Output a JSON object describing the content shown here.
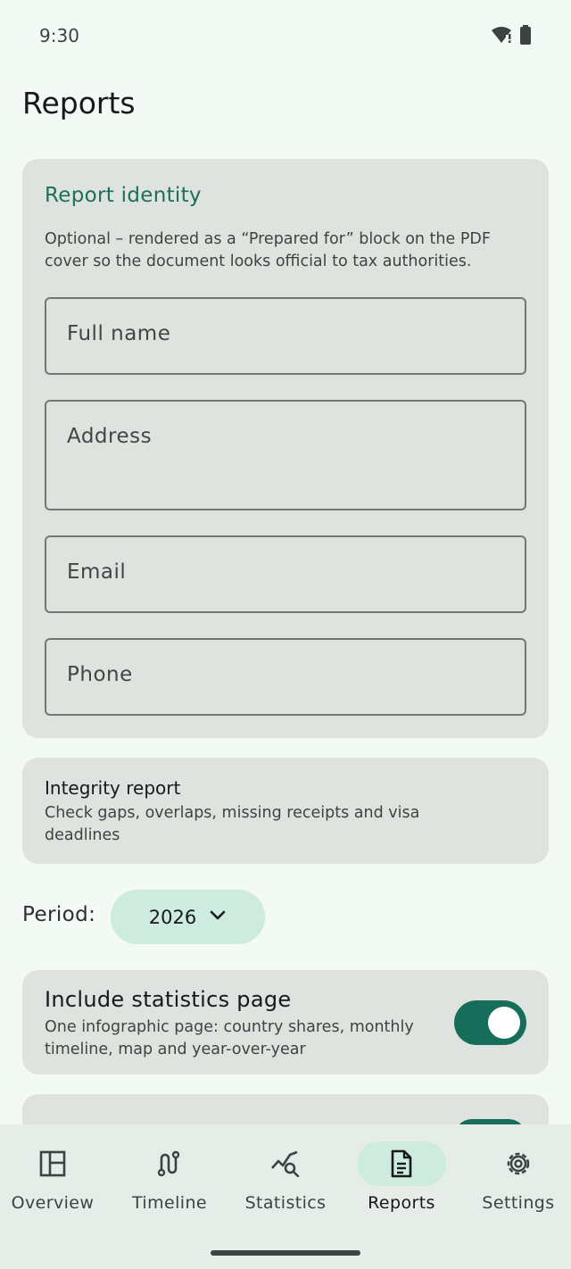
{
  "status_bar": {
    "time": "9:30"
  },
  "page": {
    "title": "Reports"
  },
  "identity": {
    "heading": "Report identity",
    "description": "Optional – rendered as a “Prepared for” block on the PDF cover so the document looks official to tax authorities.",
    "fields": {
      "full_name": "Full name",
      "address": "Address",
      "email": "Email",
      "phone": "Phone"
    }
  },
  "integrity": {
    "title": "Integrity report",
    "description": "Check gaps, overlaps, missing receipts and visa deadlines"
  },
  "period": {
    "label": "Period:",
    "value": "2026"
  },
  "statistics_option": {
    "title": "Include statistics page",
    "description": "One infographic page: country shares, monthly timeline, map and year-over-year",
    "enabled": true
  },
  "nav": {
    "items": [
      {
        "label": "Overview",
        "icon": "overview-icon"
      },
      {
        "label": "Timeline",
        "icon": "timeline-icon"
      },
      {
        "label": "Statistics",
        "icon": "statistics-icon"
      },
      {
        "label": "Reports",
        "icon": "reports-icon",
        "active": true
      },
      {
        "label": "Settings",
        "icon": "settings-icon"
      }
    ]
  },
  "colors": {
    "accent": "#1d6e5a",
    "toggle_on": "#166e5a",
    "chip_bg": "#cdebdf",
    "card_bg": "#dee3df"
  }
}
